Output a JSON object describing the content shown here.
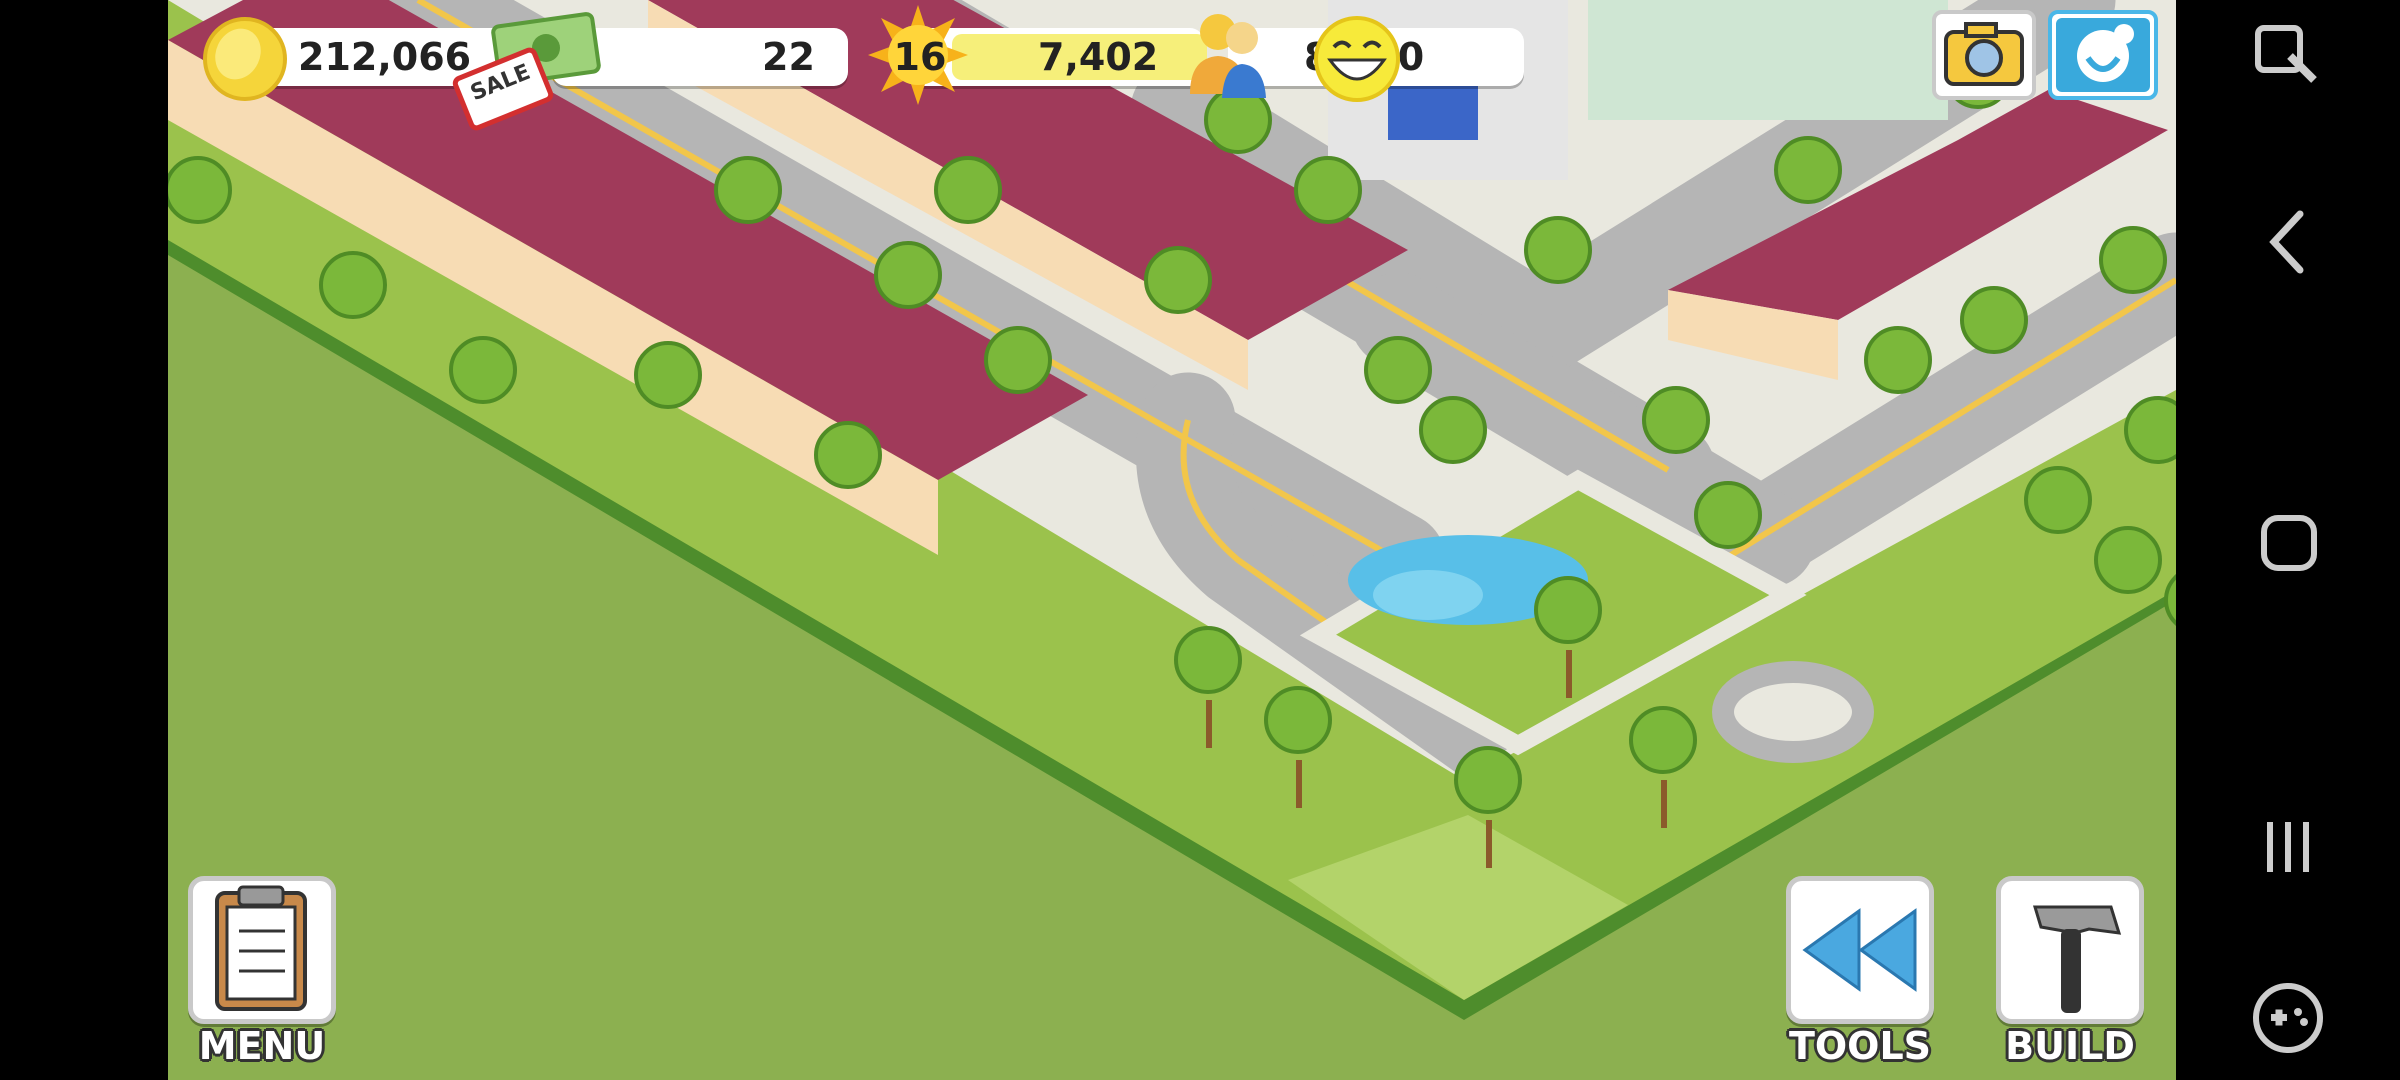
{
  "hud": {
    "coins": "212,066",
    "cash": "22",
    "sale_label": "SALE",
    "level": "16",
    "xp": "7,402",
    "population": "8,160"
  },
  "buttons": {
    "menu": "MENU",
    "tools": "TOOLS",
    "build": "BUILD"
  },
  "icons": {
    "coin": "coin-icon",
    "cash": "cash-icon",
    "level": "level-star-icon",
    "population": "population-icon",
    "happiness": "smiley-icon",
    "camera": "camera-icon",
    "social": "share-icon",
    "menu": "clipboard-icon",
    "tools": "rewind-icon",
    "build": "hammer-icon"
  },
  "colors": {
    "grass": "#8cb050",
    "road": "#b5b5b5",
    "roof": "#a03a5a",
    "xp_bar": "#f6ef7a"
  }
}
